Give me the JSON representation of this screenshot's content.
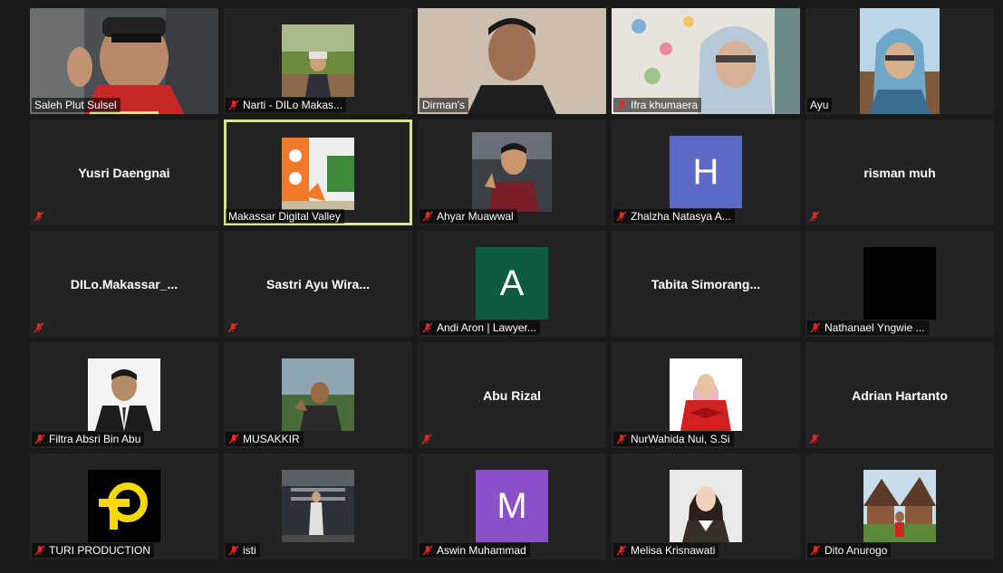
{
  "participants": [
    {
      "name": "Saleh Plut Sulsel",
      "type": "video",
      "muted": false
    },
    {
      "name": "Narti - DILo Makas...",
      "type": "photo",
      "muted": true
    },
    {
      "name": "Dirman's",
      "type": "video",
      "muted": false
    },
    {
      "name": "Ifra khumaera",
      "type": "video",
      "muted": true
    },
    {
      "name": "Ayu",
      "type": "photo",
      "muted": false
    },
    {
      "name": "Yusri Daengnai",
      "type": "name",
      "muted": true
    },
    {
      "name": "Makassar Digital Valley",
      "type": "photo",
      "muted": false,
      "active": true
    },
    {
      "name": "Ahyar Muawwal",
      "type": "photo",
      "muted": true
    },
    {
      "name": "Zhalzha Natasya A...",
      "type": "letter",
      "letter": "H",
      "color": "#5b6ac4",
      "muted": true
    },
    {
      "name": "risman muh",
      "type": "name",
      "muted": true
    },
    {
      "name": "DILo.Makassar_...",
      "type": "name",
      "muted": true
    },
    {
      "name": "Sastri Ayu Wira...",
      "type": "name",
      "muted": true
    },
    {
      "name": "Andi Aron | Lawyer...",
      "type": "letter",
      "letter": "A",
      "color": "#0e5b44",
      "muted": true
    },
    {
      "name": "Tabita  Simorang...",
      "type": "name",
      "muted": false
    },
    {
      "name": "Nathanael Yngwie ...",
      "type": "photo",
      "muted": true
    },
    {
      "name": "Filtra Absri Bin Abu",
      "type": "photo",
      "muted": true
    },
    {
      "name": "MUSAKKIR",
      "type": "photo",
      "muted": true
    },
    {
      "name": "Abu Rizal",
      "type": "name",
      "muted": true
    },
    {
      "name": "NurWahida Nui, S.Si",
      "type": "photo",
      "muted": true
    },
    {
      "name": "Adrian Hartanto",
      "type": "name",
      "muted": true
    },
    {
      "name": "TURI PRODUCTION",
      "type": "photo",
      "muted": true
    },
    {
      "name": "isti",
      "type": "photo",
      "muted": true
    },
    {
      "name": "Aswin Muhammad",
      "type": "letter",
      "letter": "M",
      "color": "#8b4fc9",
      "muted": true
    },
    {
      "name": "Melisa Krisnawati",
      "type": "photo",
      "muted": true
    },
    {
      "name": "Dito Anurogo",
      "type": "photo",
      "muted": true
    }
  ]
}
